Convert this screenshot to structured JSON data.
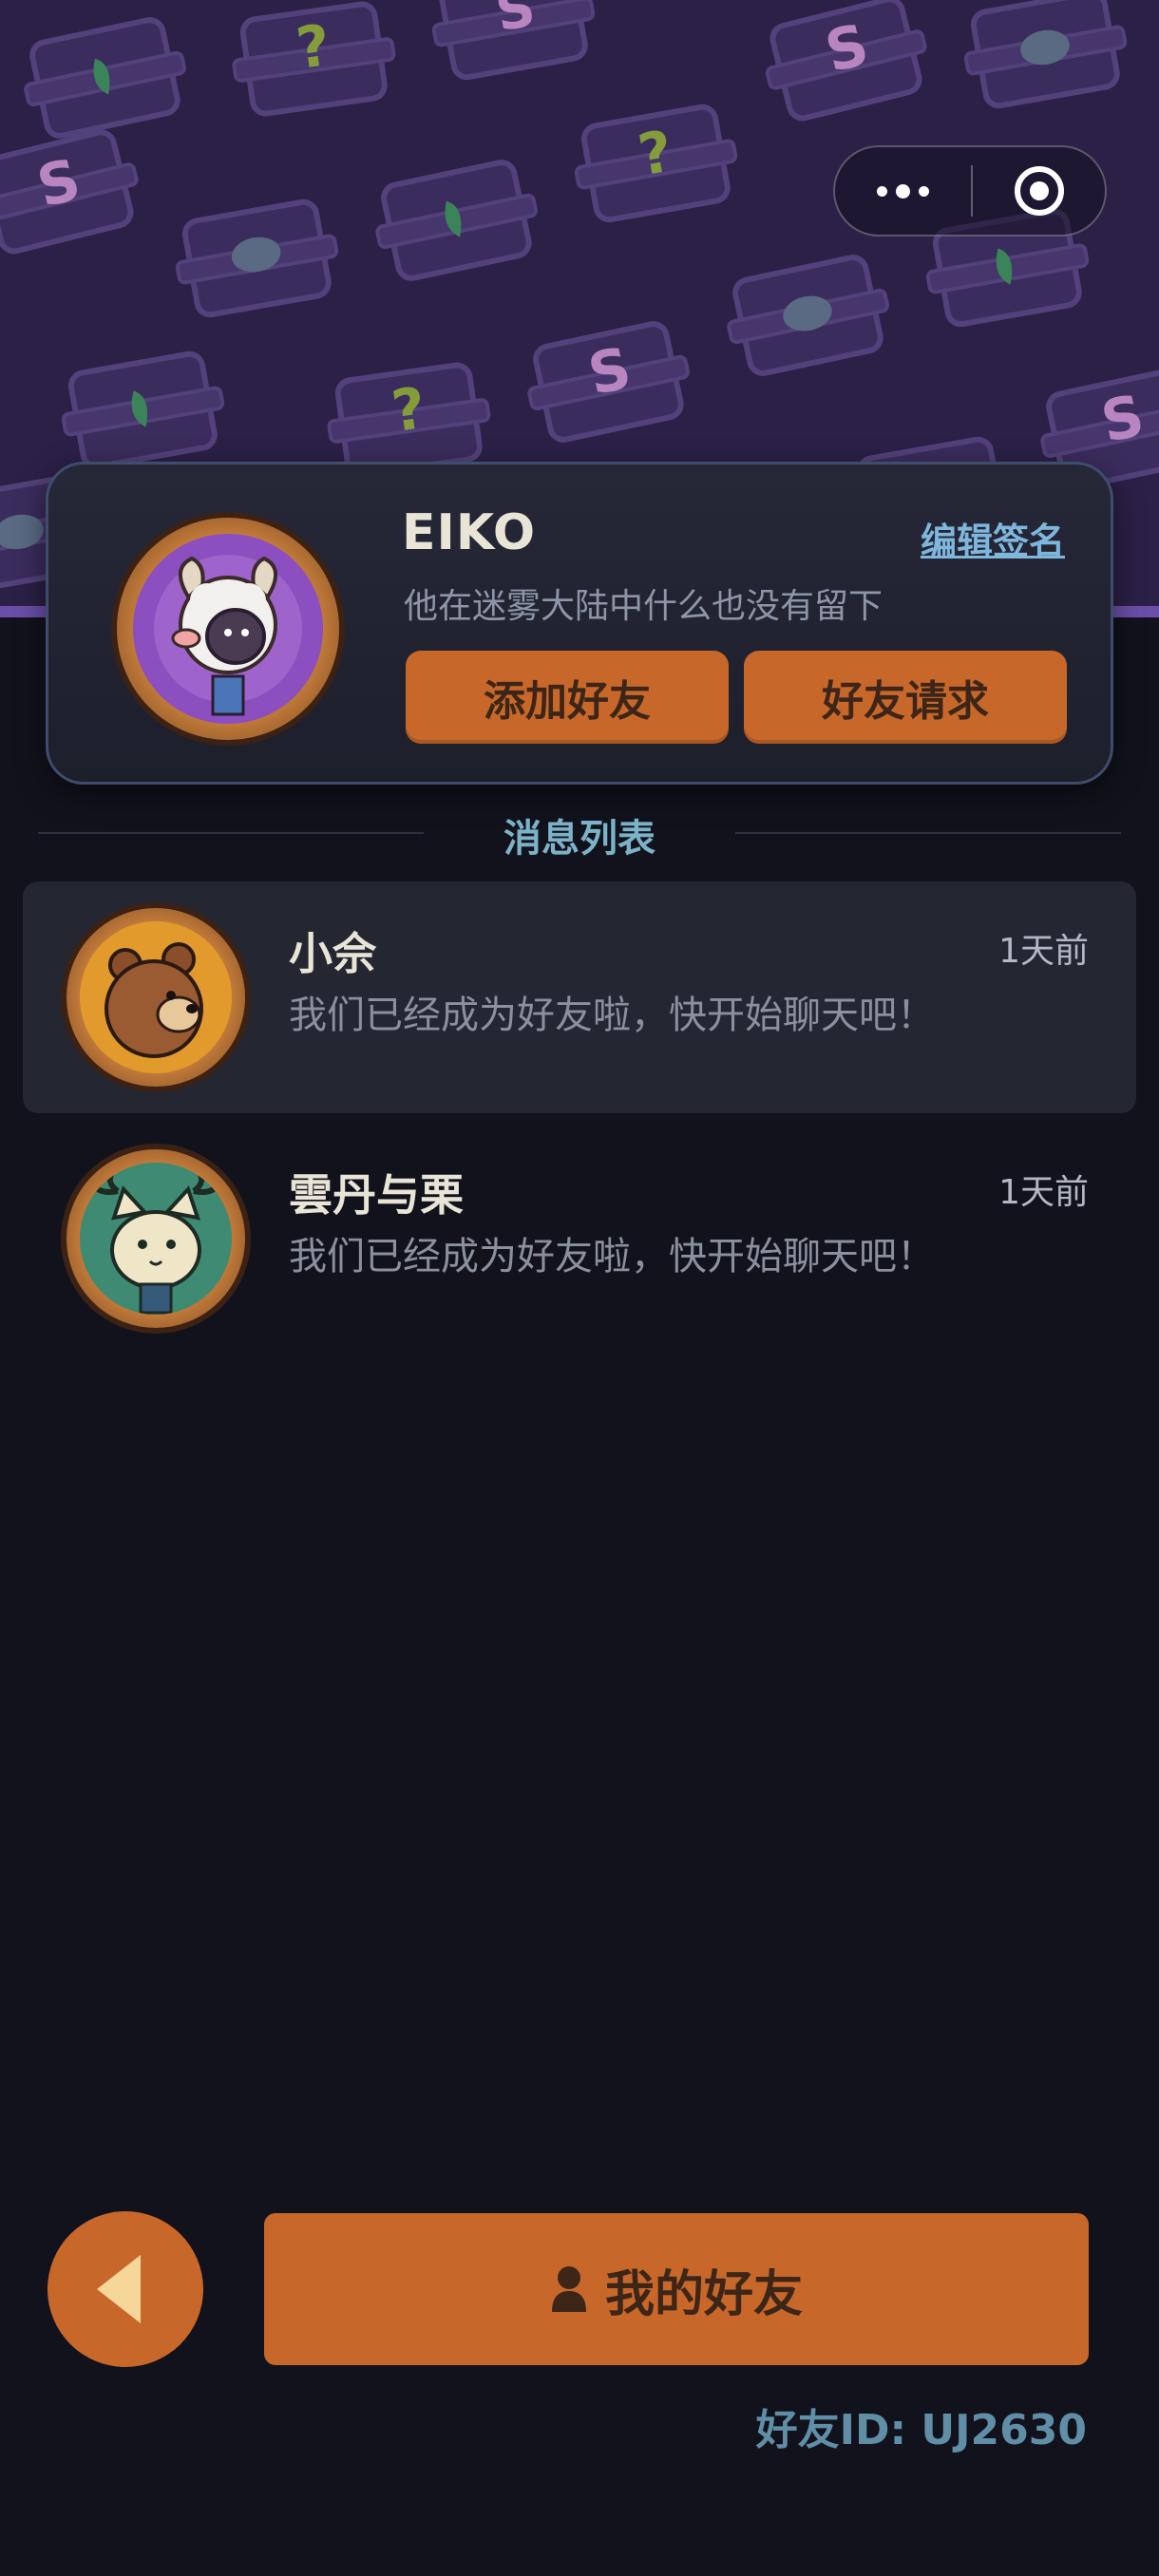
{
  "capsule": {
    "more_icon": "more-dots-icon",
    "close_icon": "target-circle-icon"
  },
  "profile": {
    "name": "EIKO",
    "edit_signature_label": "编辑签名",
    "signature": "他在迷雾大陆中什么也没有留下",
    "add_friend_label": "添加好友",
    "friend_request_label": "好友请求"
  },
  "messages": {
    "section_title": "消息列表",
    "items": [
      {
        "name": "小佘",
        "time": "1天前",
        "preview": "我们已经成为好友啦，快开始聊天吧！"
      },
      {
        "name": "雲丹与栗",
        "time": "1天前",
        "preview": "我们已经成为好友啦，快开始聊天吧！"
      }
    ]
  },
  "footer": {
    "my_friends_label": "我的好友",
    "friend_id": "好友ID: UJ2630"
  },
  "colors": {
    "accent_orange": "#c8672a",
    "banner_purple": "#2b2046",
    "background": "#12121c",
    "link_blue": "#7fb6dc"
  }
}
